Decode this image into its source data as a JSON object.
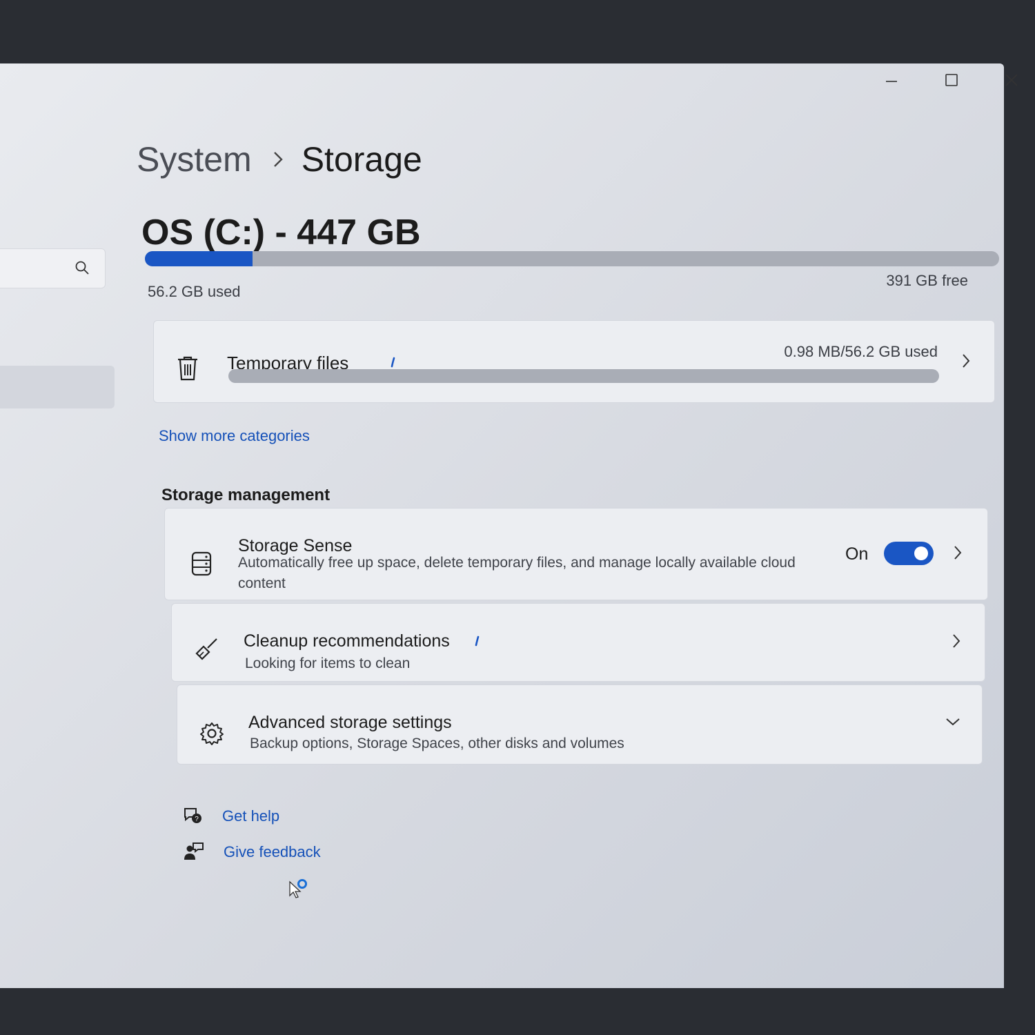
{
  "window": {
    "controls": {
      "minimize_icon": "minimize-icon",
      "maximize_icon": "maximize-icon",
      "close_icon": "close-icon"
    }
  },
  "nav": {
    "search_icon": "search-icon"
  },
  "breadcrumb": {
    "parent": "System",
    "separator_icon": "chevron-right-icon",
    "current": "Storage"
  },
  "drive": {
    "title": "OS (C:) - 447 GB",
    "used_label": "56.2 GB used",
    "free_label": "391 GB free",
    "used_fraction": 0.126,
    "accent": "#1a56c4"
  },
  "categories": {
    "temporary_files": {
      "label": "Temporary files",
      "icon": "trash-icon",
      "amount": "0.98 MB/56.2 GB used",
      "used_fraction": 0.0
    },
    "show_more": "Show more categories"
  },
  "storage_management": {
    "title": "Storage management",
    "storage_sense": {
      "title": "Storage Sense",
      "description": "Automatically free up space, delete temporary files, and manage locally available cloud content",
      "state": "On",
      "enabled": true,
      "icon": "storage-drive-icon"
    },
    "cleanup": {
      "title": "Cleanup recommendations",
      "description": "Looking for items to clean",
      "icon": "broom-icon"
    },
    "advanced": {
      "title": "Advanced storage settings",
      "description": "Backup options, Storage Spaces, other disks and volumes",
      "icon": "gear-icon"
    }
  },
  "help": {
    "get_help": "Get help",
    "give_feedback": "Give feedback"
  }
}
